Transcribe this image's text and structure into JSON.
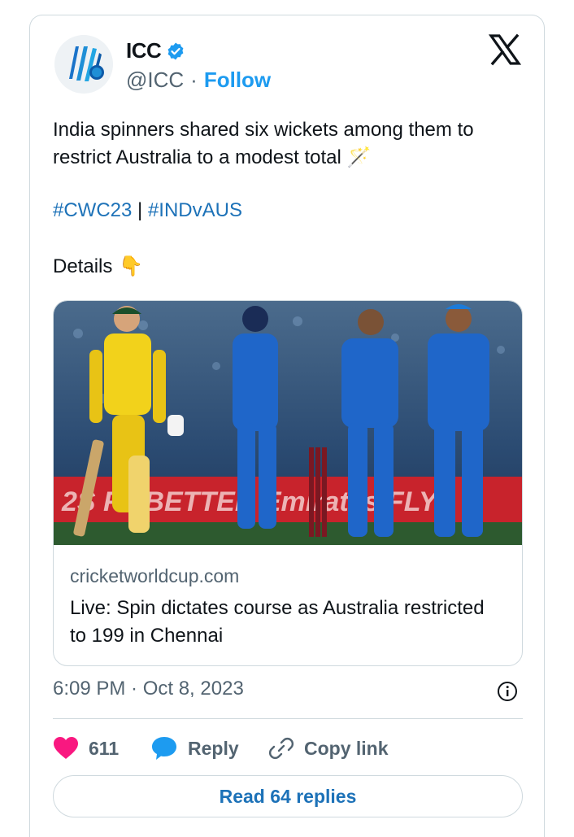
{
  "author": {
    "name": "ICC",
    "handle": "@ICC",
    "separator": "·",
    "follow_label": "Follow",
    "verified": true
  },
  "platform_icon": "x-logo-icon",
  "tweet": {
    "line1": "India spinners shared six wickets among them to",
    "line2": "restrict Australia to a modest total",
    "emoji_1": "🪄",
    "hashtag_1": "#CWC23",
    "hashtag_sep": "|",
    "hashtag_2": "#INDvAUS",
    "details_label": "Details",
    "emoji_2": "👇"
  },
  "link_card": {
    "image_desc_icon": "cricket-photo",
    "domain": "cricketworldcup.com",
    "title_line1": "Live: Spin dictates course as Australia restricted",
    "title_line2": "to 199 in Chennai"
  },
  "meta": {
    "timestamp": "6:09 PM · Oct 8, 2023"
  },
  "actions": {
    "likes_count": "611",
    "reply_label": "Reply",
    "copy_link_label": "Copy link",
    "read_replies_label": "Read 64 replies"
  },
  "colors": {
    "accent": "#1d9bf0",
    "hashtag": "#1d72b8",
    "like": "#f91880",
    "muted": "#536471"
  }
}
